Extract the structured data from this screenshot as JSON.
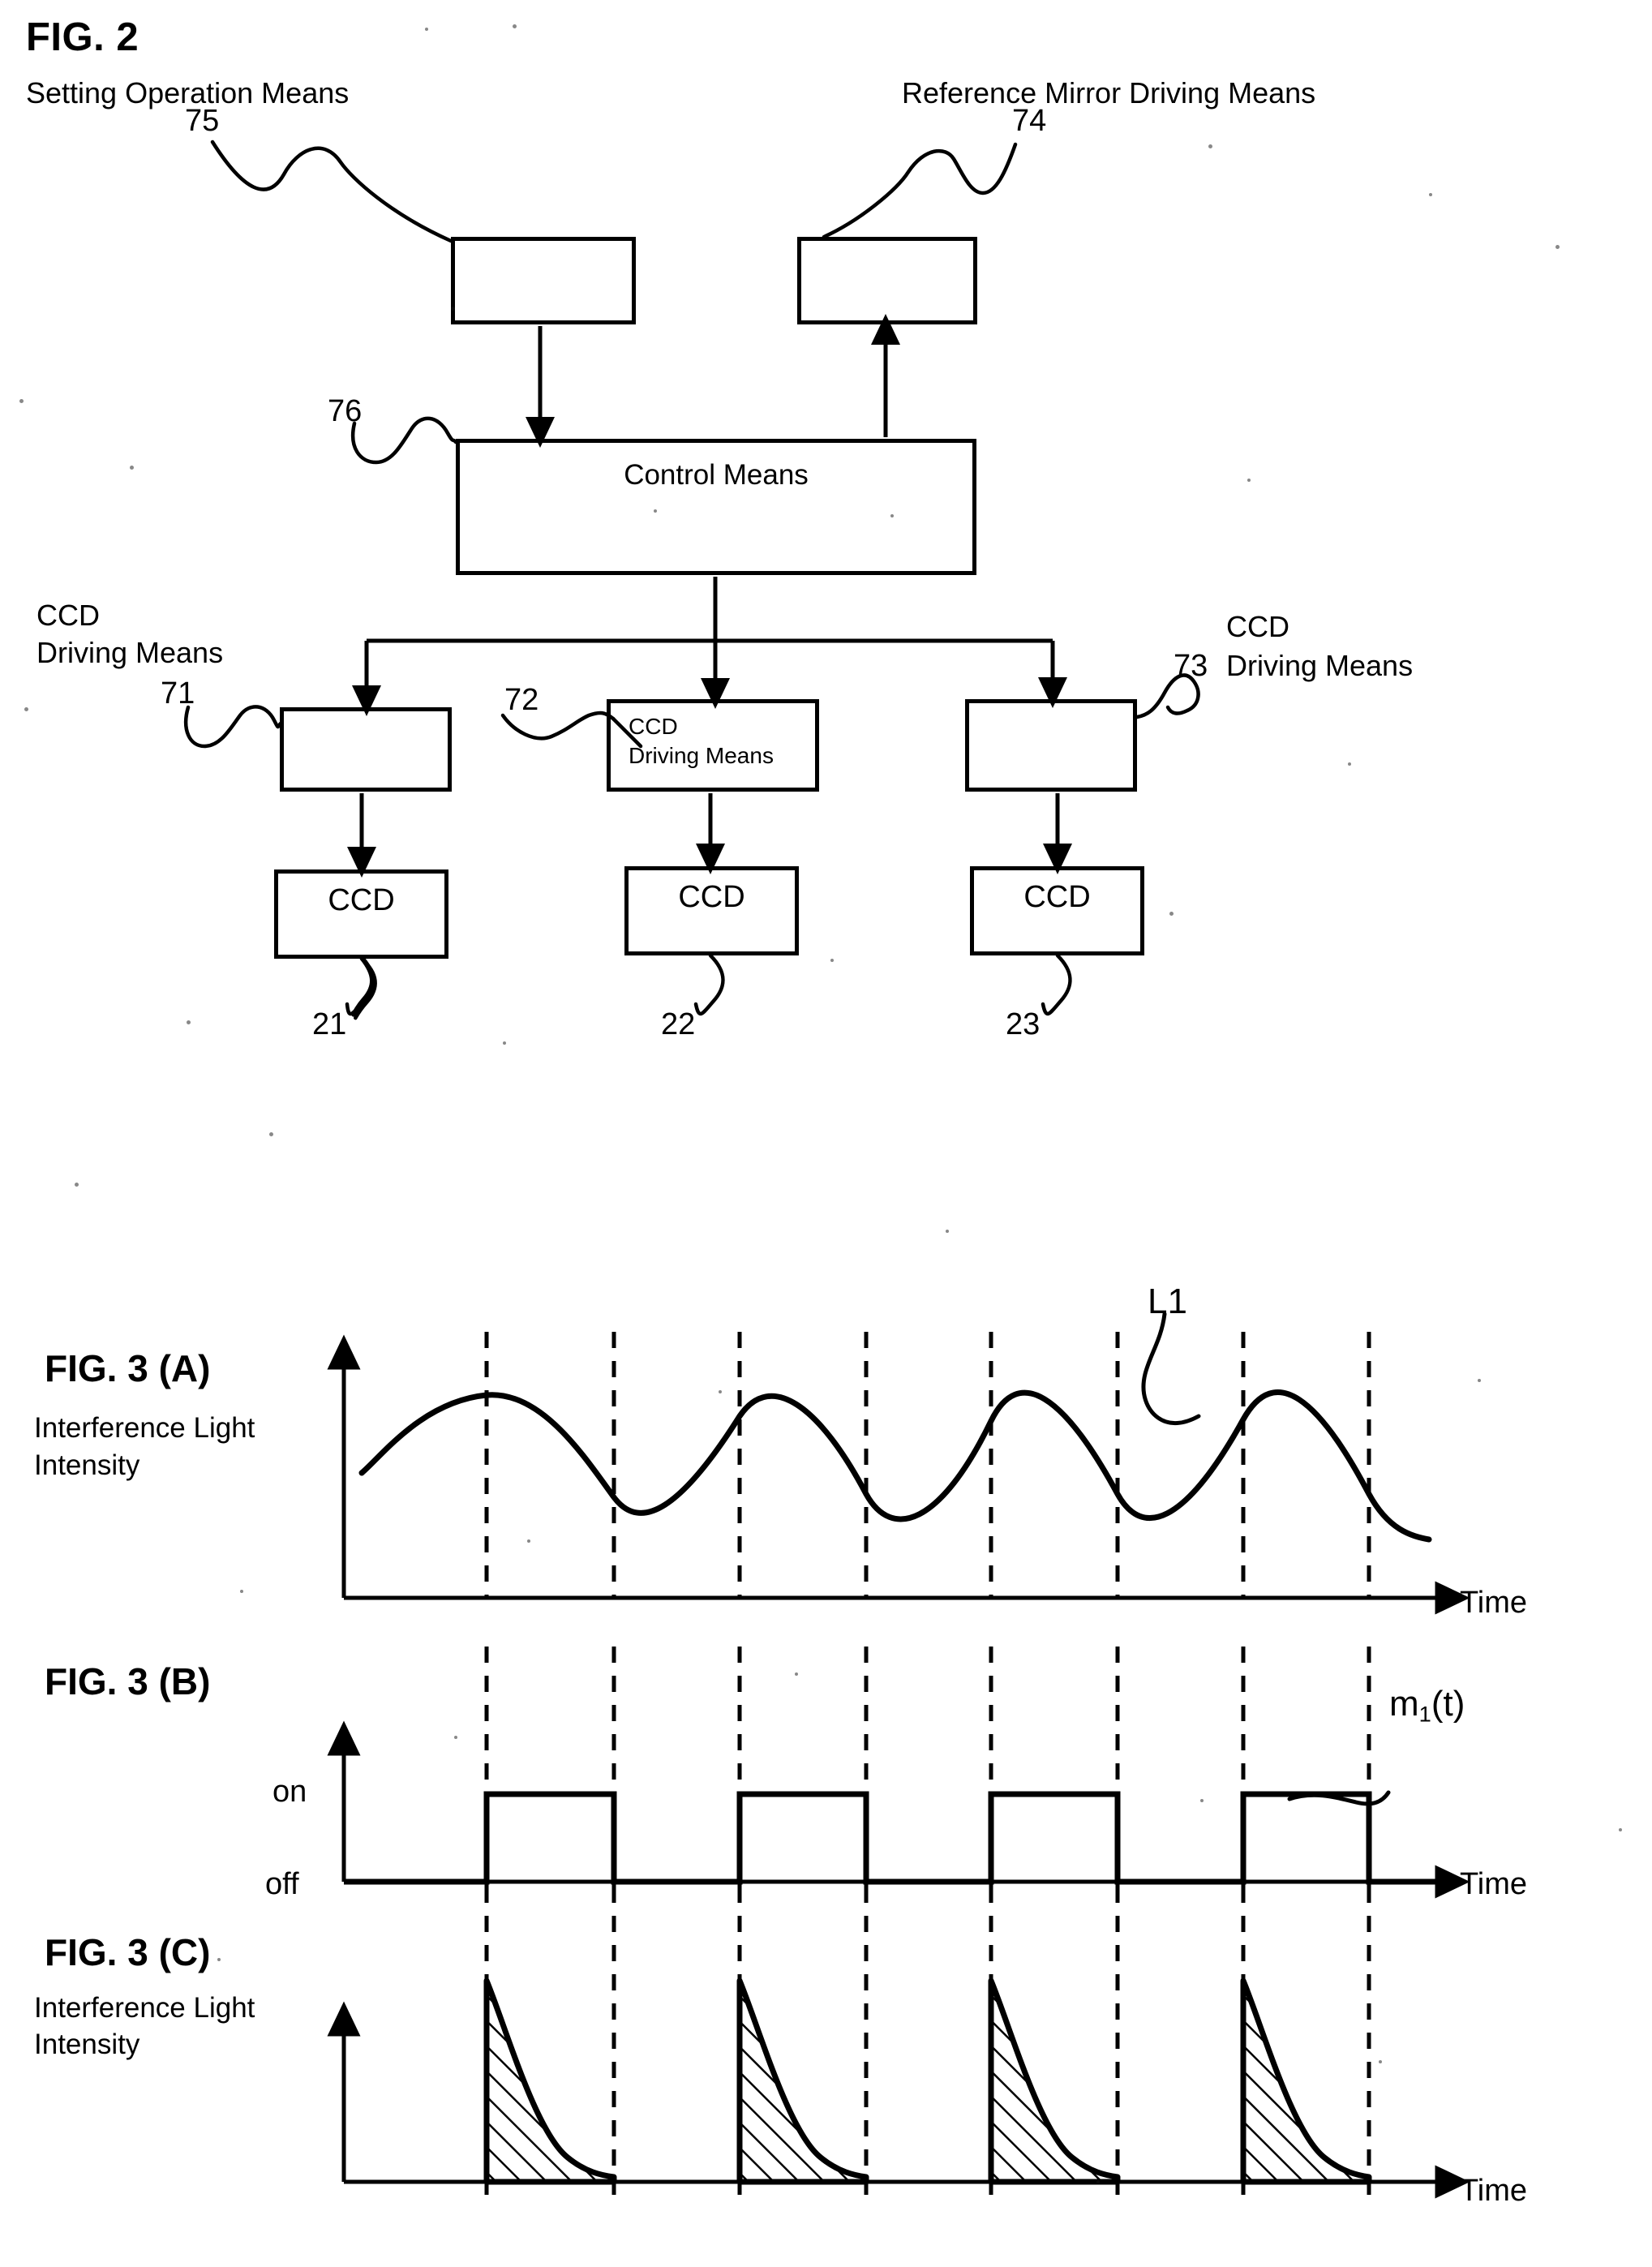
{
  "figures": {
    "fig2": {
      "title": "FIG. 2",
      "labels": {
        "setting_operation_means": "Setting Operation Means",
        "reference_mirror_driving_means": "Reference Mirror Driving Means",
        "ccd_driving_means_left": "CCD\nDriving Means",
        "ccd_driving_means_left_line1": "CCD",
        "ccd_driving_means_left_line2": "Driving Means",
        "ccd_driving_means_right_line1": "CCD",
        "ccd_driving_means_right_line2": "Driving Means",
        "control_means": "Control Means",
        "ccd_driving_means_inner_line1": "CCD",
        "ccd_driving_means_inner_line2": "Driving Means",
        "ccd_1": "CCD",
        "ccd_2": "CCD",
        "ccd_3": "CCD"
      },
      "reference_numbers": {
        "setting_operation_means": "75",
        "reference_mirror_driving_means": "74",
        "control_means": "76",
        "ccd_driving_1": "71",
        "ccd_driving_2": "72",
        "ccd_driving_3": "73",
        "ccd_1": "21",
        "ccd_2": "22",
        "ccd_3": "23"
      }
    },
    "fig3a": {
      "title": "FIG. 3 (A)",
      "y_axis_label_line1": "Interference Light",
      "y_axis_label_line2": "Intensity",
      "x_axis_label": "Time",
      "curve_label": "L1"
    },
    "fig3b": {
      "title": "FIG. 3 (B)",
      "y_tick_on": "on",
      "y_tick_off": "off",
      "x_axis_label": "Time",
      "curve_label_main": "m",
      "curve_label_sub": "1",
      "curve_label_tail": "(t)"
    },
    "fig3c": {
      "title": "FIG. 3 (C)",
      "y_axis_label_line1": "Interference Light",
      "y_axis_label_line2": "Intensity",
      "x_axis_label": "Time"
    }
  },
  "chart_data": [
    {
      "type": "line",
      "id": "fig3a",
      "title": "FIG. 3 (A)",
      "ylabel": "Interference Light Intensity",
      "xlabel": "Time",
      "series": [
        {
          "name": "L1",
          "description": "sinusoidal interference light intensity, 4 peaks",
          "waveform": "sine",
          "cycles": 4,
          "peak_x": [
            560,
            865,
            1170,
            1475
          ],
          "trough_x": [
            712,
            1017,
            1322,
            1627
          ]
        }
      ],
      "gridlines": {
        "vertical_dashed_x": [
          560,
          712,
          865,
          1017,
          1170,
          1322,
          1475,
          1627
        ],
        "style": "dashed"
      },
      "legend": "none",
      "annotations": [
        "L1"
      ]
    },
    {
      "type": "line",
      "id": "fig3b",
      "title": "FIG. 3 (B)",
      "ylabel": "",
      "xlabel": "Time",
      "ytick_labels": [
        "on",
        "off"
      ],
      "series": [
        {
          "name": "m1(t)",
          "description": "square wave gate signal, high between trough and peak markers",
          "waveform": "square",
          "pulses": [
            {
              "start": 560,
              "end": 712
            },
            {
              "start": 865,
              "end": 1017
            },
            {
              "start": 1170,
              "end": 1322
            },
            {
              "start": 1475,
              "end": 1627
            }
          ]
        }
      ],
      "gridlines": {
        "vertical_dashed_x": [
          560,
          712,
          865,
          1017,
          1170,
          1322,
          1475,
          1627
        ],
        "style": "dashed"
      },
      "annotations": [
        "m1(t)"
      ]
    },
    {
      "type": "area",
      "id": "fig3c",
      "title": "FIG. 3 (C)",
      "ylabel": "Interference Light Intensity",
      "xlabel": "Time",
      "series": [
        {
          "name": "gated interference light intensity",
          "description": "hatched decaying lobes sampled while m1(t) is on",
          "fill": "diagonal-hatch",
          "lobes": [
            {
              "start": 560,
              "end": 712
            },
            {
              "start": 865,
              "end": 1017
            },
            {
              "start": 1170,
              "end": 1322
            },
            {
              "start": 1475,
              "end": 1627
            }
          ]
        }
      ],
      "gridlines": {
        "vertical_dashed_x": [
          560,
          712,
          865,
          1017,
          1170,
          1322,
          1475,
          1627
        ],
        "style": "dashed"
      }
    }
  ],
  "colors": {
    "ink": "#000000",
    "paper": "#ffffff"
  }
}
